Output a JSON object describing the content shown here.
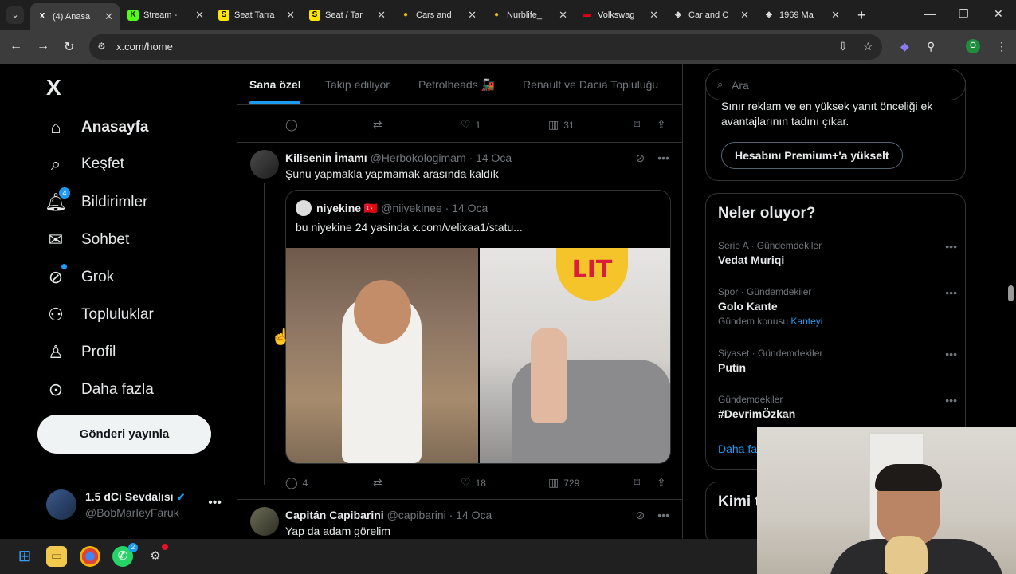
{
  "browser": {
    "tabs": [
      {
        "label": "(4) Anasa",
        "icon": "x-icon",
        "color": "#000000",
        "glyph": "X"
      },
      {
        "label": "Stream -",
        "icon": "kick-icon",
        "color": "#53fc18",
        "glyph": "K"
      },
      {
        "label": "Seat Tarra",
        "icon": "s-icon",
        "color": "#ffe600",
        "glyph": "S"
      },
      {
        "label": "Seat / Tar",
        "icon": "s-icon",
        "color": "#ffe600",
        "glyph": "S"
      },
      {
        "label": "Cars and",
        "icon": "nurb-icon",
        "color": "#e6c300",
        "glyph": "●"
      },
      {
        "label": "Nurblife_",
        "icon": "nurb-icon",
        "color": "#e6c300",
        "glyph": "●"
      },
      {
        "label": "Volkswag",
        "icon": "vw-icon",
        "color": "#d4001a",
        "glyph": "▬"
      },
      {
        "label": "Car and C",
        "icon": "shield-icon",
        "color": "#3c3c3c",
        "glyph": "◈"
      },
      {
        "label": "1969 Ma",
        "icon": "shield-icon",
        "color": "#3c3c3c",
        "glyph": "◈"
      }
    ],
    "url": "x.com/home",
    "profile_initial": "Ö"
  },
  "sidebar": {
    "logo": "X",
    "items": [
      {
        "label": "Anasayfa",
        "icon": "home-icon",
        "glyph": "⌂"
      },
      {
        "label": "Keşfet",
        "icon": "search-icon",
        "glyph": "⌕"
      },
      {
        "label": "Bildirimler",
        "icon": "bell-icon",
        "glyph": "♪",
        "badge": "4"
      },
      {
        "label": "Sohbet",
        "icon": "envelope-icon",
        "glyph": "✉"
      },
      {
        "label": "Grok",
        "icon": "grok-icon",
        "glyph": "⊘"
      },
      {
        "label": "Topluluklar",
        "icon": "people-icon",
        "glyph": "⚇"
      },
      {
        "label": "Profil",
        "icon": "person-icon",
        "glyph": "♙"
      },
      {
        "label": "Daha fazla",
        "icon": "more-circle-icon",
        "glyph": "⊙"
      }
    ],
    "post_button": "Gönderi yayınla",
    "account": {
      "name": "1.5 dCi Sevdalısı",
      "handle": "@BobMarIeyFaruk"
    }
  },
  "timeline": {
    "tabs": [
      "Sana özel",
      "Takip ediliyor",
      "Petrolheads 🚂",
      "Renault ve Dacia Topluluğu"
    ],
    "top_actions": {
      "replies": "",
      "reposts": "",
      "likes": "1",
      "views": "31"
    },
    "tweet1": {
      "name": "Kilisenin İmamı",
      "handle": "@Herbokologimam",
      "date": "· 14 Oca",
      "text": "Şunu yapmakla yapmamak arasında kaldık",
      "quote": {
        "name": "niyekine",
        "flag": "🇹🇷",
        "handle": "@niiyekinee",
        "date": "· 14 Oca",
        "text": "bu niyekine 24 yasinda  x.com/velixaa1/statu...",
        "sticker": "LIT"
      },
      "actions": {
        "replies": "4",
        "reposts": "",
        "likes": "18",
        "views": "729"
      }
    },
    "tweet2": {
      "name": "Capitán Capibarini",
      "handle": "@capibarini",
      "date": "· 14 Oca",
      "text": "Yap da adam görelim"
    }
  },
  "right": {
    "search_placeholder": "Ara",
    "premium_text": "Sınır reklam ve en yüksek yanıt önceliği ek avantajlarının tadını çıkar.",
    "premium_button": "Hesabını Premium+'a yükselt",
    "trends_title": "Neler oluyor?",
    "trends": [
      {
        "category": "Serie A · Gündemdekiler",
        "name": "Vedat Muriqi",
        "sub": "",
        "link": ""
      },
      {
        "category": "Spor · Gündemdekiler",
        "name": "Golo Kante",
        "sub": "Gündem konusu",
        "link": "Kanteyi"
      },
      {
        "category": "Siyaset · Gündemdekiler",
        "name": "Putin",
        "sub": "",
        "link": ""
      },
      {
        "category": "Gündemdekiler",
        "name": "#DevrimÖzkan",
        "sub": "",
        "link": ""
      }
    ],
    "show_more": "Daha fa",
    "who_title": "Kimi t"
  },
  "taskbar": {
    "whatsapp_badge": "2"
  },
  "colors": {
    "accent": "#1d9bf0",
    "background": "#000000",
    "muted": "#71767b"
  }
}
